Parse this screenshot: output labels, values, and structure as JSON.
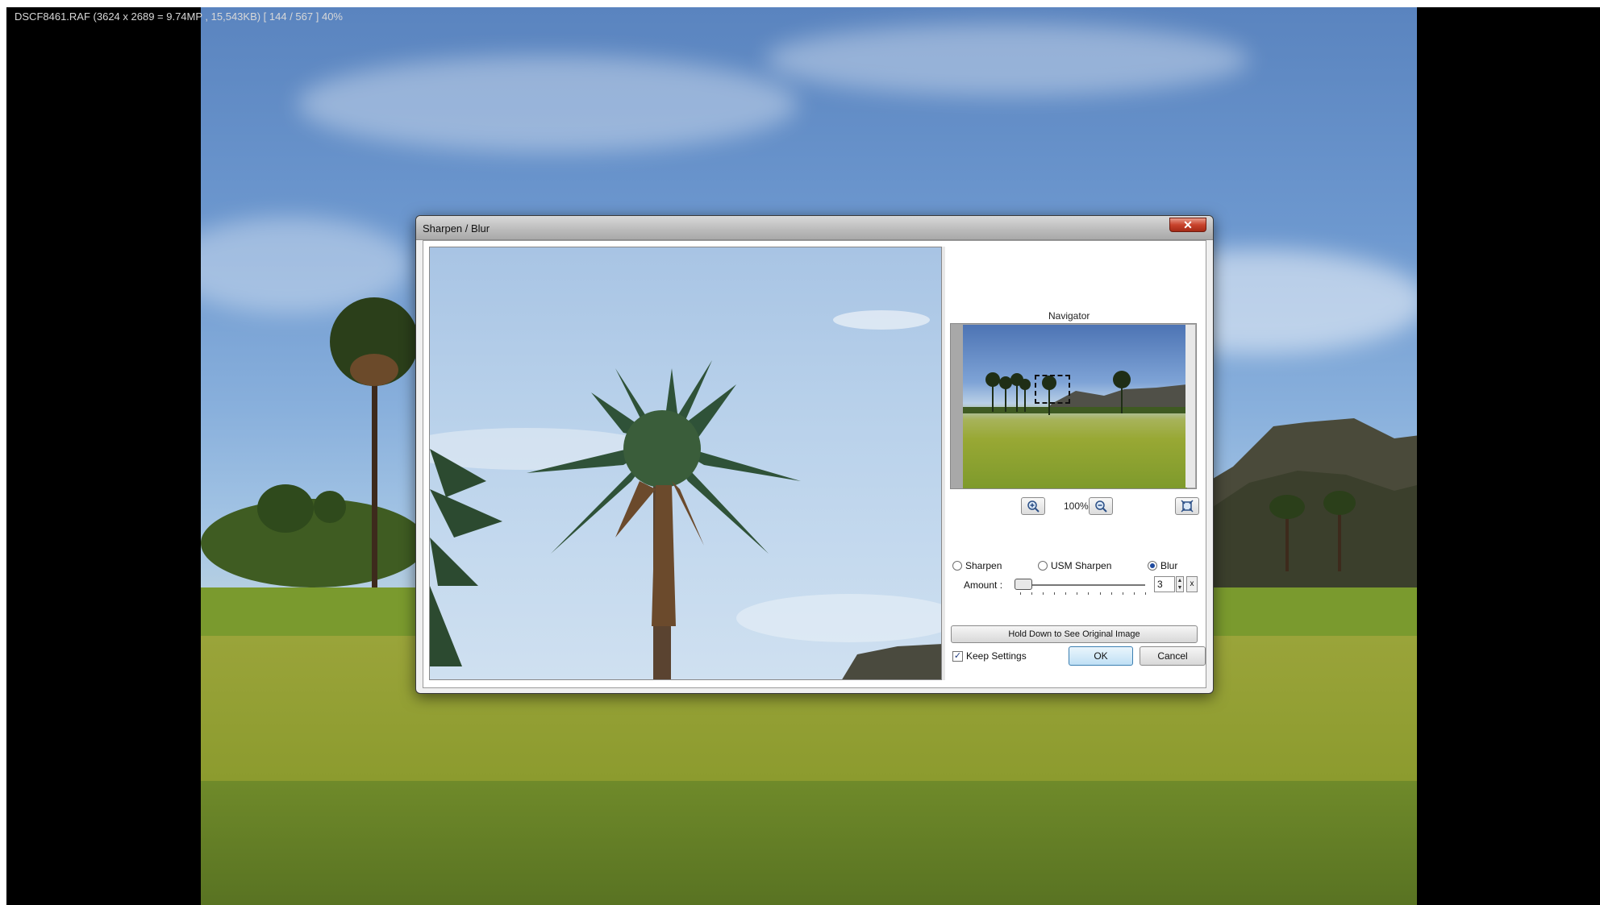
{
  "viewer": {
    "status_text": "DSCF8461.RAF  (3624 x 2689 = 9.74MP  ,  15,543KB)  [ 144 / 567 ]   40%"
  },
  "dialog": {
    "title": "Sharpen / Blur",
    "close_icon": "close-icon",
    "navigator": {
      "label": "Navigator",
      "zoom_level": "100%",
      "zoom_in_icon": "zoom-in-icon",
      "zoom_out_icon": "zoom-out-icon",
      "fit_icon": "fit-to-window-icon"
    },
    "modes": [
      {
        "label": "Sharpen",
        "selected": false
      },
      {
        "label": "USM Sharpen",
        "selected": false
      },
      {
        "label": "Blur",
        "selected": true
      }
    ],
    "amount": {
      "label": "Amount :",
      "value": "3",
      "reset_label": "x"
    },
    "hold_button_label": "Hold Down to See Original Image",
    "keep_settings": {
      "label": "Keep Settings",
      "checked": true
    },
    "ok_label": "OK",
    "cancel_label": "Cancel"
  },
  "colors": {
    "accent": "#3c7fb1",
    "close_button": "#c8432c"
  }
}
